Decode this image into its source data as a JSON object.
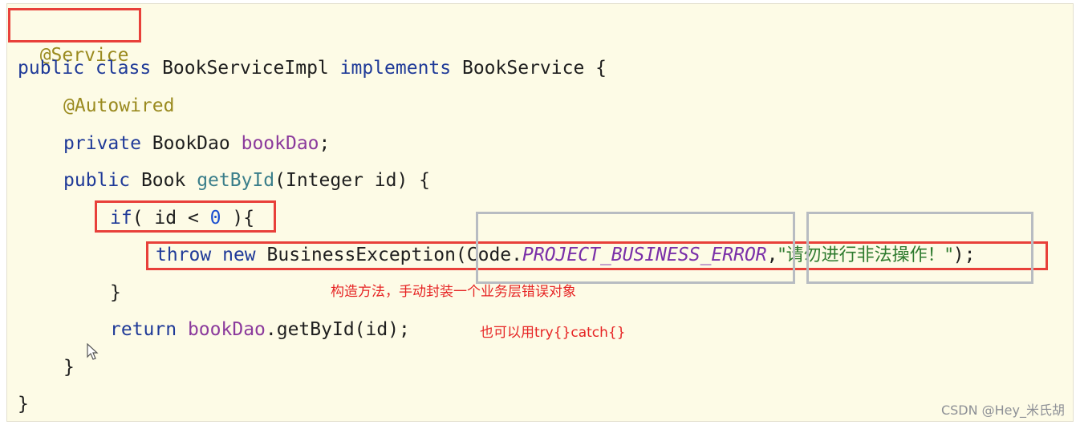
{
  "code": {
    "l1_annotation": "@Service",
    "l2_public": "public",
    "l2_class": "class",
    "l2_name": "BookServiceImpl",
    "l2_implements": "implements",
    "l2_iface": "BookService {",
    "l3_annotation": "@Autowired",
    "l4_private": "private",
    "l4_type": "BookDao",
    "l4_field": "bookDao",
    "l4_semi": ";",
    "l5_public": "public",
    "l5_type": "Book",
    "l5_method": "getById",
    "l5_params": "(Integer id) {",
    "l6_if": "if",
    "l6_cond_a": "( id < ",
    "l6_zero": "0",
    "l6_cond_b": " ){",
    "l7_throw": "throw",
    "l7_new": "new",
    "l7_call": "BusinessException(",
    "l7_code": "Code.",
    "l7_const": "PROJECT_BUSINESS_ERROR",
    "l7_comma": ",",
    "l7_string": "\"请勿进行非法操作！\"",
    "l7_end": ");",
    "l8_close": "}",
    "l9_return": "return",
    "l9_field": "bookDao",
    "l9_call": ".getById(id);",
    "l10_close": "}",
    "l11_close": "}"
  },
  "notes": {
    "constructor_note": "构造方法，手动封装一个业务层错误对象",
    "trycatch_note": "也可以用try{}catch{}"
  },
  "watermark": "CSDN @Hey_米氏胡",
  "colors": {
    "keyword": "#1f3a98",
    "annotation": "#9a8a1f",
    "field": "#8b3a9c",
    "constant": "#7a2fa8",
    "string": "#2d7a2d",
    "highlight_box": "#e8403a",
    "note_text": "#e62424"
  },
  "icons": {
    "cursor": "mouse-pointer-icon"
  }
}
